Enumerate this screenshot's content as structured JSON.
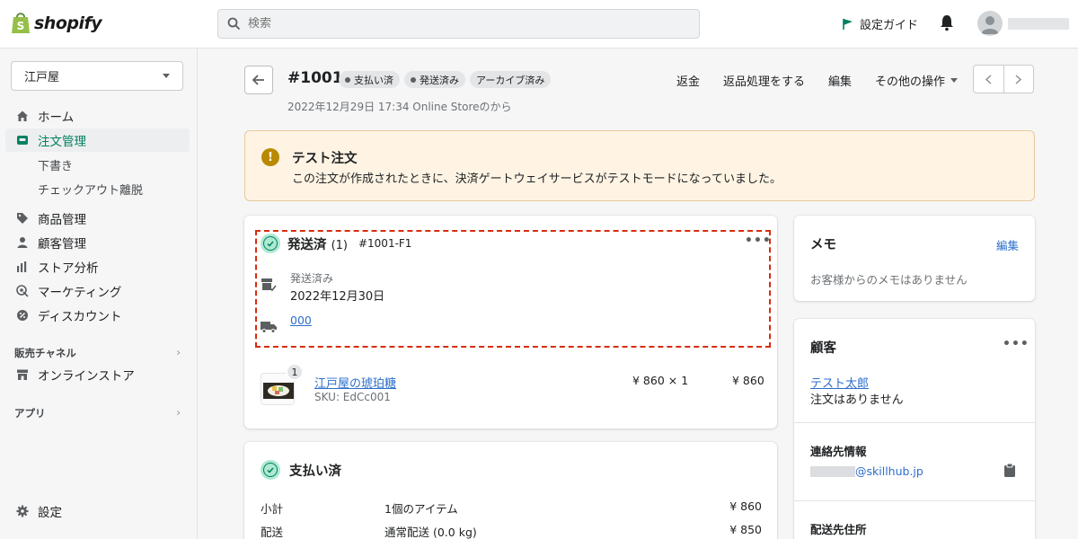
{
  "brand": {
    "name": "shopify",
    "accent": "#008060",
    "logo_bag_color": "#95bf47"
  },
  "topbar": {
    "search_placeholder": "検索",
    "setup_guide_label": "設定ガイド"
  },
  "sidebar": {
    "store_name": "江戸屋",
    "items": [
      {
        "label": "ホーム",
        "icon": "home-icon"
      },
      {
        "label": "注文管理",
        "icon": "orders-icon",
        "active": true
      },
      {
        "label": "商品管理",
        "icon": "tag-icon"
      },
      {
        "label": "顧客管理",
        "icon": "person-icon"
      },
      {
        "label": "ストア分析",
        "icon": "bar-chart-icon"
      },
      {
        "label": "マーケティング",
        "icon": "target-icon"
      },
      {
        "label": "ディスカウント",
        "icon": "discount-icon"
      }
    ],
    "sub_items": [
      "下書き",
      "チェックアウト離脱"
    ],
    "sales_channels_label": "販売チャネル",
    "online_store_label": "オンラインストア",
    "apps_label": "アプリ",
    "settings_label": "設定"
  },
  "order": {
    "number": "#1001",
    "badges": [
      {
        "label": "支払い済",
        "dot": true
      },
      {
        "label": "発送済み",
        "dot": true
      },
      {
        "label": "アーカイブ済み",
        "dot": false
      }
    ],
    "date_line": "2022年12月29日 17:34 Online Storeのから",
    "actions": [
      "返金",
      "返品処理をする",
      "編集",
      "その他の操作"
    ]
  },
  "banner": {
    "title": "テスト注文",
    "body": "この注文が作成されたときに、決済ゲートウェイサービスがテストモードになっていました。",
    "bg_color": "#fff4e4"
  },
  "fulfillment": {
    "title": "発送済",
    "count": "(1)",
    "id": "#1001-F1",
    "status_label": "発送済み",
    "status_date": "2022年12月30日",
    "tracking_number": "000",
    "item": {
      "quantity": "1",
      "name": "江戸屋の琥珀糖",
      "sku": "SKU: EdCc001",
      "unit_price": "¥ 860 × 1",
      "total": "¥ 860"
    }
  },
  "payment": {
    "title": "支払い済",
    "rows": [
      {
        "label": "小計",
        "desc": "1個のアイテム",
        "amount": "¥ 860"
      },
      {
        "label": "配送",
        "desc": "通常配送 (0.0 kg)",
        "amount": "¥ 850"
      }
    ]
  },
  "memo": {
    "title": "メモ",
    "edit_label": "編集",
    "body": "お客様からのメモはありません"
  },
  "customer": {
    "title": "顧客",
    "name": "テスト太郎",
    "orders_text": "注文はありません",
    "contact_title": "連絡先情報",
    "email_domain": "@skillhub.jp",
    "address_title": "配送先住所"
  }
}
